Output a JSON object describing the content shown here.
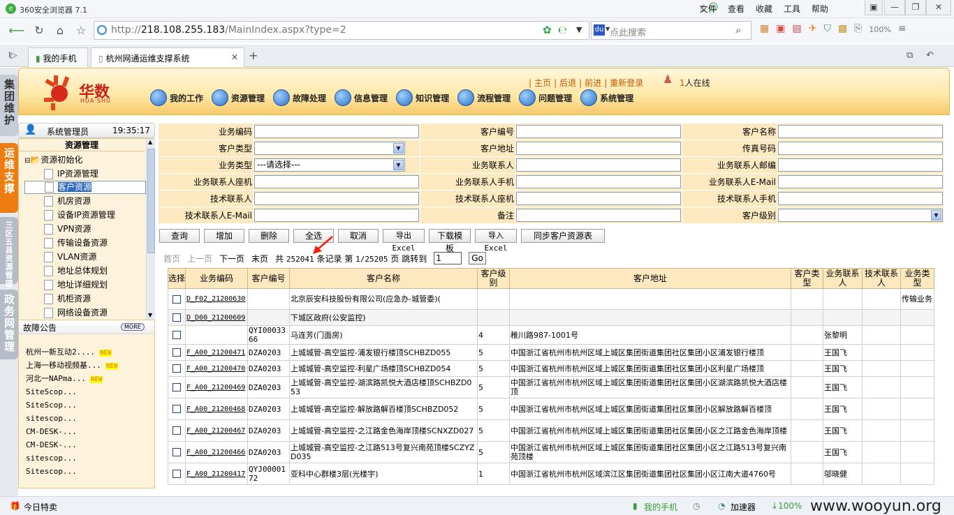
{
  "browser": {
    "title": "360安全浏览器 7.1",
    "menus": [
      "文件",
      "查看",
      "收藏",
      "工具",
      "帮助"
    ],
    "url_prefix": "http://",
    "url_host": "218.108.255.183",
    "url_path": "/MainIndex.aspx?type=2",
    "search_placeholder": "点此搜索",
    "tabs": [
      {
        "label": "我的手机"
      },
      {
        "label": "杭州网通运维支撑系统"
      }
    ]
  },
  "vtabs": [
    {
      "label": "集团维护",
      "color": "#d9dde3"
    },
    {
      "label": "运维支撑",
      "color": "#ee7d11"
    },
    {
      "label": "三区五县资源管理",
      "color": "#b9c0ca"
    },
    {
      "label": "政务网管理",
      "color": "#b9c0ca"
    }
  ],
  "header": {
    "logo_text": "华数",
    "logo_sub": "HUA SHU",
    "links": [
      "主页",
      "后退",
      "前进",
      "重新登录"
    ],
    "online_count": "1",
    "online_text": "人在线",
    "menu": [
      "我的工作",
      "资源管理",
      "故障处理",
      "信息管理",
      "知识管理",
      "流程管理",
      "问题管理",
      "系统管理"
    ]
  },
  "user": {
    "name": "系统管理员",
    "time": "19:35:17"
  },
  "resource": {
    "title": "资源管理",
    "root": "资源初始化",
    "items": [
      "IP资源管理",
      "客户资源",
      "机房资源",
      "设备IP资源管理",
      "VPN资源",
      "传输设备资源",
      "VLAN资源",
      "地址总体规划",
      "地址详细规划",
      "机柜资源",
      "网络设备资源"
    ],
    "selected": 1
  },
  "faults": {
    "title": "故障公告",
    "more": "MORE",
    "items": [
      {
        "t": "杭州一新互动2....",
        "new": "NEW"
      },
      {
        "t": "上海一移动视频基...",
        "new": "NEW"
      },
      {
        "t": "河北一NAPma...",
        "new": "NEW"
      },
      {
        "t": "SiteScop...",
        "new": ""
      },
      {
        "t": "SiteScop...",
        "new": ""
      },
      {
        "t": "sitescop...",
        "new": ""
      },
      {
        "t": "CM-DESK-...",
        "new": ""
      },
      {
        "t": "CM-DESK-...",
        "new": ""
      },
      {
        "t": "sitescop...",
        "new": ""
      },
      {
        "t": "Sitescop...",
        "new": ""
      }
    ]
  },
  "form": {
    "rows": [
      [
        {
          "l": "业务编码",
          "t": "in",
          "v": ""
        },
        {
          "l": "客户编号",
          "t": "in",
          "v": ""
        },
        {
          "l": "客户名称",
          "t": "in",
          "v": ""
        }
      ],
      [
        {
          "l": "客户类型",
          "t": "sel",
          "v": ""
        },
        {
          "l": "客户地址",
          "t": "in",
          "v": ""
        },
        {
          "l": "传真号码",
          "t": "in",
          "v": ""
        }
      ],
      [
        {
          "l": "业务类型",
          "t": "sel",
          "v": "---请选择---"
        },
        {
          "l": "业务联系人",
          "t": "in",
          "v": ""
        },
        {
          "l": "业务联系人邮编",
          "t": "in",
          "v": ""
        }
      ],
      [
        {
          "l": "业务联系人座机",
          "t": "in",
          "v": ""
        },
        {
          "l": "业务联系人手机",
          "t": "in",
          "v": ""
        },
        {
          "l": "业务联系人E-Mail",
          "t": "in",
          "v": ""
        }
      ],
      [
        {
          "l": "技术联系人",
          "t": "in",
          "v": ""
        },
        {
          "l": "技术联系人座机",
          "t": "in",
          "v": ""
        },
        {
          "l": "技术联系人手机",
          "t": "in",
          "v": ""
        }
      ],
      [
        {
          "l": "技术联系人E-Mail",
          "t": "in",
          "v": ""
        },
        {
          "l": "备注",
          "t": "in",
          "v": ""
        },
        {
          "l": "客户级别",
          "t": "sel",
          "v": ""
        }
      ]
    ]
  },
  "buttons": [
    "查询",
    "增加",
    "删除",
    "全选",
    "取消",
    "导出Excel",
    "下载模板",
    "导入Excel",
    "同步客户资源表"
  ],
  "pager": {
    "first": "首页",
    "prev": "上一页",
    "next": "下一页",
    "last": "末页",
    "total_pre": "共",
    "total": "252041",
    "total_post": "条记录",
    "page_pre": "第",
    "page": "1/25205",
    "page_post": "页",
    "jump": "跳转到",
    "jump_val": "1",
    "go": "Go"
  },
  "table": {
    "headers": [
      "选择",
      "业务编码",
      "客户编号",
      "客户名称",
      "客户级别",
      "客户地址",
      "客户类型",
      "业务联系人",
      "技术联系人",
      "业务类型"
    ],
    "rows": [
      [
        "D_F02_21200630",
        "",
        "北京辰安科技股份有限公司(应急办-城管委)(",
        "",
        "",
        "",
        "",
        "",
        "传输业务"
      ],
      [
        "D_D00_21200609",
        "",
        "下城区政府(公安监控)",
        "",
        "",
        "",
        "",
        "",
        ""
      ],
      [
        "",
        "QYI0003366",
        "马连芳(门面房)",
        "4",
        "稚川路987-1001号",
        "",
        "张黎明",
        "",
        ""
      ],
      [
        "F_A00_21200471",
        "DZA0203",
        "上城城管-高空监控-浦发银行楼顶SCHBZD055",
        "5",
        "中国浙江省杭州市杭州区域上城区集团街道集团社区集团小区浦发银行楼顶",
        "",
        "王国飞",
        "",
        ""
      ],
      [
        "F_A00_21200470",
        "DZA0203",
        "上城城管-高空监控-利星广场楼顶SCHBZD054",
        "5",
        "中国浙江省杭州市杭州区域上城区集团街道集团社区集团小区利星广场楼顶",
        "",
        "王国飞",
        "",
        ""
      ],
      [
        "F_A00_21200469",
        "DZA0203",
        "上城城管-高空监控-湖滨路凯悦大酒店楼顶SCHBZD053",
        "5",
        "中国浙江省杭州市杭州区域上城区集团街道集团社区集团小区湖滨路凯悦大酒店楼顶",
        "",
        "王国飞",
        "",
        ""
      ],
      [
        "F_A00_21200468",
        "DZA0203",
        "上城城管-高空监控-解放路解百楼顶SCHBZD052",
        "5",
        "中国浙江省杭州市杭州区域上城区集团街道集团社区集团小区解放路解百楼顶",
        "",
        "王国飞",
        "",
        ""
      ],
      [
        "F_A00_21200467",
        "DZA0203",
        "上城城管-高空监控-之江路金色海岸顶楼SCNXZD027",
        "5",
        "中国浙江省杭州市杭州区域上城区集团街道集团社区集团小区之江路金色海岸顶楼",
        "",
        "王国飞",
        "",
        ""
      ],
      [
        "F_A00_21200466",
        "DZA0203",
        "上城城管-高空监控-之江路513号复兴南苑顶楼SCZYZD035",
        "5",
        "中国浙江省杭州市杭州区域上城区集团街道集团社区集团小区之江路513号复兴南苑顶楼",
        "",
        "王国飞",
        "",
        ""
      ],
      [
        "F_A00_21200417",
        "QYJ0000172",
        "亚科中心群楼3层(光楼宇)",
        "1",
        "中国浙江省杭州市杭州区域滨江区集团街道集团社区集团小区江南大道4760号",
        "",
        "邬晓健",
        "",
        ""
      ]
    ]
  },
  "status": {
    "left": "今日特卖",
    "phone": "我的手机",
    "speed": "加速器",
    "pct": "100%",
    "zoom": "100%",
    "watermark": "www.wooyun.org"
  }
}
